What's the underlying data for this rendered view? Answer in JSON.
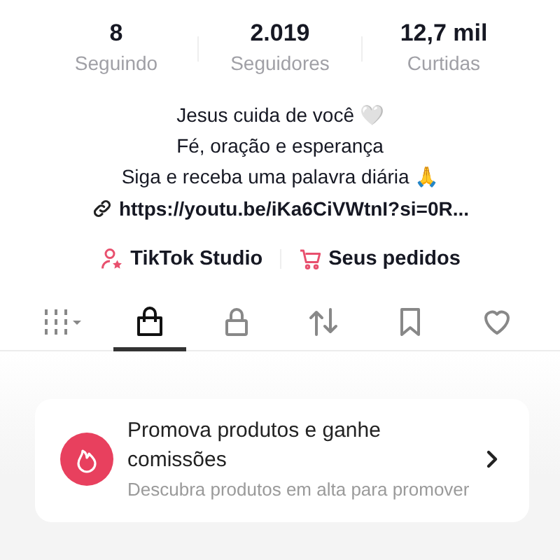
{
  "stats": [
    {
      "value": "8",
      "label": "Seguindo"
    },
    {
      "value": "2.019",
      "label": "Seguidores"
    },
    {
      "value": "12,7 mil",
      "label": "Curtidas"
    }
  ],
  "bio": [
    "Jesus cuida de você 🤍",
    "Fé, oração e esperança",
    "Siga e receba uma palavra diária 🙏"
  ],
  "link": "https://youtu.be/iKa6CiVWtnI?si=0R...",
  "shortcuts": [
    {
      "kind": "studio",
      "label": "TikTok Studio"
    },
    {
      "kind": "orders",
      "label": "Seus pedidos"
    }
  ],
  "tabs": [
    {
      "kind": "grid",
      "selected": false
    },
    {
      "kind": "shop",
      "selected": true
    },
    {
      "kind": "lock",
      "selected": false
    },
    {
      "kind": "repost",
      "selected": false
    },
    {
      "kind": "bookmark",
      "selected": false
    },
    {
      "kind": "heart",
      "selected": false
    }
  ],
  "promo": {
    "title": "Promova produtos e ganhe comissões",
    "subtitle": "Descubra produtos em alta para promover"
  }
}
